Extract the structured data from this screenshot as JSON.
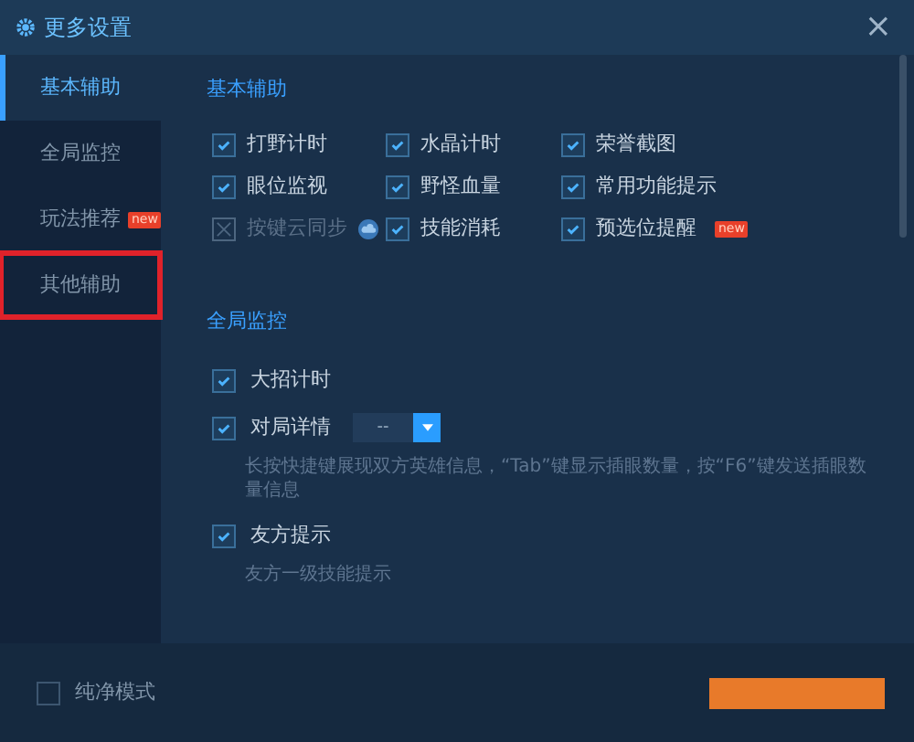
{
  "window": {
    "title": "更多设置",
    "close": "×"
  },
  "sidebar": {
    "items": [
      {
        "label": "基本辅助",
        "selected": true,
        "highlighted": false
      },
      {
        "label": "全局监控",
        "selected": false,
        "highlighted": false
      },
      {
        "label": "玩法推荐",
        "selected": false,
        "highlighted": false,
        "badge": "new"
      },
      {
        "label": "其他辅助",
        "selected": false,
        "highlighted": true
      }
    ]
  },
  "sections": [
    {
      "title": "基本辅助",
      "options": [
        {
          "label": "打野计时",
          "checked": true,
          "disabled": false
        },
        {
          "label": "水晶计时",
          "checked": true,
          "disabled": false
        },
        {
          "label": "荣誉截图",
          "checked": true,
          "disabled": false
        },
        {
          "label": "眼位监视",
          "checked": true,
          "disabled": false
        },
        {
          "label": "野怪血量",
          "checked": true,
          "disabled": false
        },
        {
          "label": "常用功能提示",
          "checked": true,
          "disabled": false
        },
        {
          "label": "按键云同步",
          "disabled": true,
          "cloud": true
        },
        {
          "label": "技能消耗",
          "checked": true,
          "disabled": false
        },
        {
          "label": "预选位提醒",
          "checked": true,
          "disabled": false,
          "badge": "new"
        }
      ]
    },
    {
      "title": "全局监控",
      "options": [
        {
          "label": "大招计时",
          "checked": true
        },
        {
          "label": "对局详情",
          "checked": true,
          "dropdown": "--",
          "description": "长按快捷键展现双方英雄信息，“Tab”键显示插眼数量，按“F6”键发送插眼数量信息"
        },
        {
          "label": "友方提示",
          "checked": true,
          "description": "友方一级技能提示"
        }
      ]
    }
  ],
  "footer": {
    "pure_mode": {
      "label": "纯净模式",
      "checked": false
    }
  }
}
